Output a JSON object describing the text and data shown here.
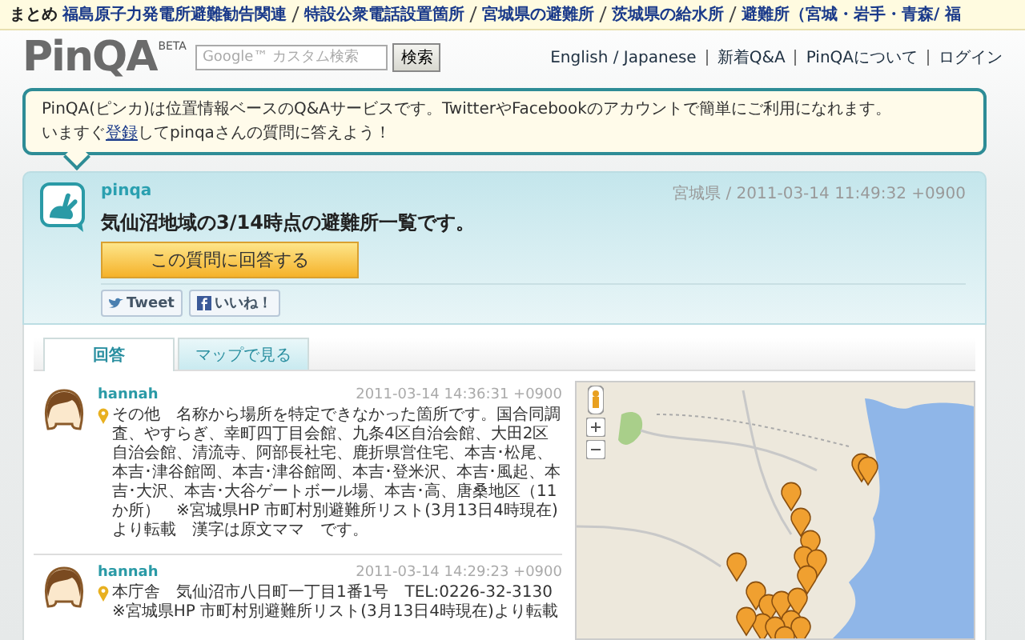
{
  "top_bar": {
    "label": "まとめ",
    "links": [
      "福島原子力発電所避難勧告関連",
      "特設公衆電話設置箇所",
      "宮城県の避難所",
      "茨城県の給水所",
      "避難所（宮城・岩手・青森/ 福"
    ]
  },
  "header": {
    "logo": "PinQA",
    "logo_badge": "BETA",
    "search": {
      "placeholder": "Google™ カスタム検索",
      "button": "検索"
    },
    "nav": [
      "English / Japanese",
      "新着Q&A",
      "PinQAについて",
      "ログイン"
    ]
  },
  "intro": {
    "line1": "PinQA(ピンカ)は位置情報ベースのQ&Aサービスです。TwitterやFacebookのアカウントで簡単にご利用になれます。",
    "line2_before": "いますぐ",
    "line2_link": "登録",
    "line2_after": "してpinqaさんの質問に答えよう！"
  },
  "question": {
    "user": "pinqa",
    "meta": "宮城県 / 2011-03-14 11:49:32 +0900",
    "title": "気仙沼地域の3/14時点の避難所一覧です。",
    "answer_button": "この質問に回答する",
    "share": [
      {
        "kind": "tweet",
        "label": "Tweet"
      },
      {
        "kind": "like",
        "label": "いいね！"
      }
    ]
  },
  "tabs": [
    {
      "label": "回答",
      "selected": true
    },
    {
      "label": "マップで見る",
      "selected": false
    }
  ],
  "answers": [
    {
      "user": "hannah",
      "time": "2011-03-14 14:36:31 +0900",
      "text": "その他　名称から場所を特定できなかった箇所です。国合同調査、やすらぎ、幸町四丁目会館、九条4区自治会館、大田2区自治会館、清流寺、阿部長社宅、鹿折県営住宅、本吉･松尾、本吉･津谷館岡、本吉･津谷館岡、本吉･登米沢、本吉･風起、本吉･大沢、本吉･大谷ゲートボール場、本吉･高、唐桑地区（11か所）　※宮城県HP 市町村別避難所リスト(3月13日4時現在)より転載　漢字は原文ママ　です。"
    },
    {
      "user": "hannah",
      "time": "2011-03-14 14:29:23 +0900",
      "text": "本庁舎　気仙沼市八日町一丁目1番1号　TEL:0226-32-3130 ※宮城県HP 市町村別避難所リスト(3月13日4時現在)より転載"
    }
  ]
}
